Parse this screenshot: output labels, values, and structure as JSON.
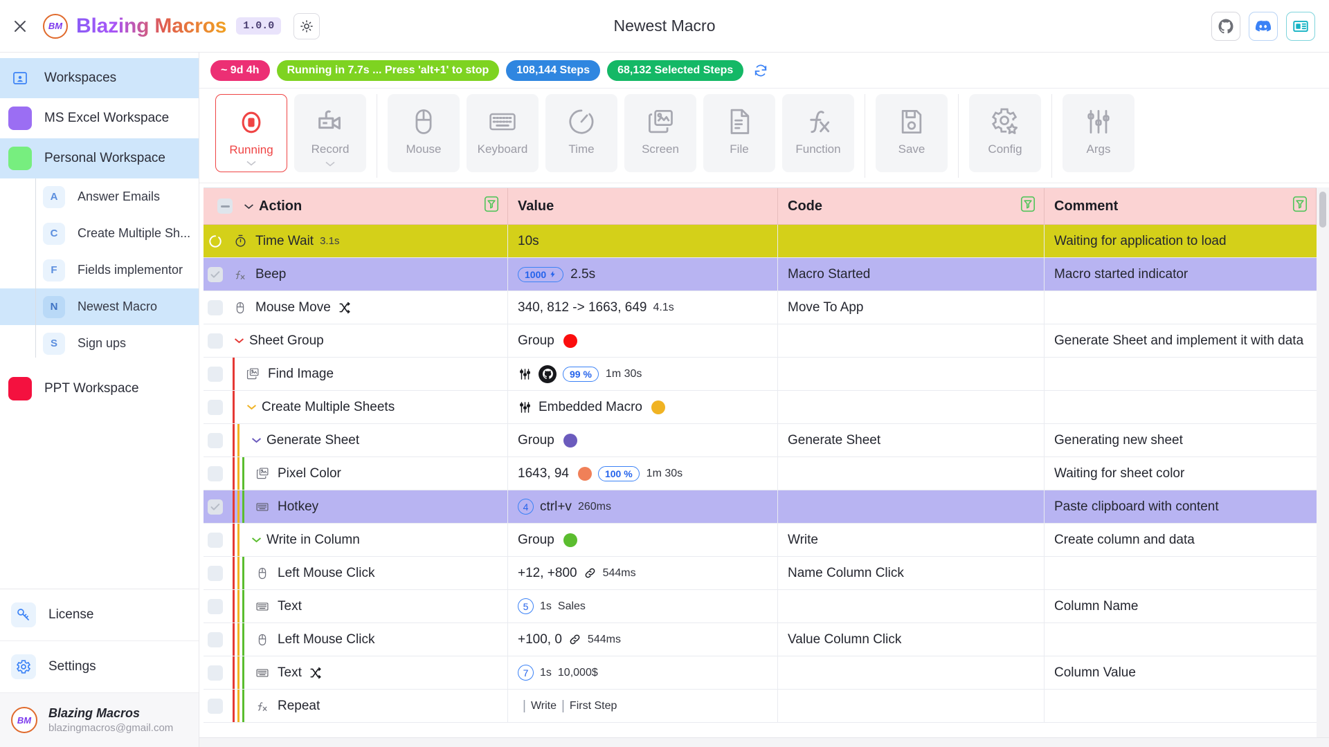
{
  "app": {
    "brand": "Blazing Macros",
    "version": "1.0.0",
    "window_title": "Newest Macro",
    "close_icon": "close-icon",
    "theme_icon": "sun-icon",
    "github_icon": "github-icon",
    "discord_icon": "discord-icon",
    "news_icon": "news-icon"
  },
  "sidebar": {
    "workspaces_label": "Workspaces",
    "workspaces": [
      {
        "label": "MS Excel Workspace",
        "color": "#9b6ef3",
        "active": false
      },
      {
        "label": "Personal Workspace",
        "color": "#77ee7f",
        "active": true
      }
    ],
    "macros": [
      {
        "initial": "A",
        "label": "Answer Emails",
        "active": false
      },
      {
        "initial": "C",
        "label": "Create Multiple Sh...",
        "active": false
      },
      {
        "initial": "F",
        "label": "Fields implementor",
        "active": false
      },
      {
        "initial": "N",
        "label": "Newest Macro",
        "active": true
      },
      {
        "initial": "S",
        "label": "Sign ups",
        "active": false
      }
    ],
    "workspace_last": {
      "label": "PPT Workspace",
      "color": "#f4113f"
    },
    "footer": [
      {
        "label": "License",
        "icon": "key-icon"
      },
      {
        "label": "Settings",
        "icon": "gear-icon"
      }
    ],
    "user": {
      "name": "Blazing Macros",
      "email": "blazingmacros@gmail.com"
    }
  },
  "status": {
    "badges": [
      {
        "text": "~ 9d 4h",
        "color": "#ec2f74"
      },
      {
        "text": "Running in 7.7s ... Press 'alt+1' to stop",
        "color": "#7ed321"
      },
      {
        "text": "108,144 Steps",
        "color": "#2f86e0"
      },
      {
        "text": "68,132 Selected Steps",
        "color": "#14b866"
      }
    ],
    "refresh_icon": "refresh-icon"
  },
  "toolbar": {
    "groups": [
      [
        {
          "label": "Running",
          "icon": "record-stop-icon",
          "active": true,
          "caret": true
        },
        {
          "label": "Record",
          "icon": "camera-icon",
          "active": false,
          "caret": true
        }
      ],
      [
        {
          "label": "Mouse",
          "icon": "mouse-icon"
        },
        {
          "label": "Keyboard",
          "icon": "keyboard-icon"
        },
        {
          "label": "Time",
          "icon": "timer-icon"
        },
        {
          "label": "Screen",
          "icon": "image-icon"
        },
        {
          "label": "File",
          "icon": "file-icon"
        },
        {
          "label": "Function",
          "icon": "function-icon"
        }
      ],
      [
        {
          "label": "Save",
          "icon": "save-icon"
        }
      ],
      [
        {
          "label": "Config",
          "icon": "config-gear-icon"
        }
      ],
      [
        {
          "label": "Args",
          "icon": "sliders-icon"
        }
      ]
    ]
  },
  "table": {
    "columns": [
      {
        "key": "action",
        "label": "Action",
        "filter": true
      },
      {
        "key": "value",
        "label": "Value",
        "filter": false
      },
      {
        "key": "code",
        "label": "Code",
        "filter": true
      },
      {
        "key": "comment",
        "label": "Comment",
        "filter": true
      }
    ],
    "rows": [
      {
        "action": "Time Wait",
        "duration": "3.1s",
        "icon": "stopwatch-icon",
        "value_text": "10s",
        "code": "",
        "comment": "Waiting for application to load",
        "highlight": "#d4d019",
        "indent": 0,
        "check": "spinner",
        "caret": null,
        "shuffle": false
      },
      {
        "action": "Beep",
        "duration": "",
        "icon": "fx-icon",
        "value_badge": "1000",
        "value_badge_icon": "lightning-icon",
        "value_text": "2.5s",
        "code": "Macro Started",
        "comment": "Macro started indicator",
        "highlight": "#b8b4f2",
        "indent": 0,
        "check": "checked",
        "caret": null,
        "shuffle": false
      },
      {
        "action": "Mouse Move",
        "duration": "",
        "icon": "mouse-icon",
        "value_text": "340, 812 -> 1663, 649",
        "value_dur": "4.1s",
        "code": "Move To App",
        "comment": "",
        "highlight": "",
        "indent": 0,
        "check": "empty",
        "caret": null,
        "shuffle": true
      },
      {
        "action": "Sheet Group",
        "duration": "",
        "icon": "",
        "value_text": "Group",
        "value_dot": "#fb0d0d",
        "code": "",
        "comment": "Generate Sheet and implement it with data",
        "highlight": "",
        "indent": 0,
        "check": "empty",
        "caret": "#e53935",
        "shuffle": false
      },
      {
        "action": "Find Image",
        "duration": "",
        "icon": "image-icon",
        "value_sliders": true,
        "value_github": true,
        "value_badge": "99 %",
        "value_dur": "1m 30s",
        "code": "",
        "comment": "",
        "highlight": "",
        "indent": 1,
        "check": "empty",
        "caret": null,
        "shuffle": false
      },
      {
        "action": "Create Multiple Sheets",
        "duration": "",
        "icon": "",
        "value_sliders": true,
        "value_text": "Embedded Macro",
        "value_dot": "#f0b323",
        "code": "",
        "comment": "",
        "highlight": "",
        "indent": 1,
        "check": "empty",
        "caret": "#f0b323",
        "shuffle": false
      },
      {
        "action": "Generate Sheet",
        "duration": "",
        "icon": "",
        "value_text": "Group",
        "value_dot": "#6b5bbd",
        "code": "Generate Sheet",
        "comment": "Generating new sheet",
        "highlight": "",
        "indent": 2,
        "check": "empty",
        "caret": "#6b5bbd",
        "shuffle": false
      },
      {
        "action": "Pixel Color",
        "duration": "",
        "icon": "image-icon",
        "value_text": "1643, 94",
        "value_dot": "#f08058",
        "value_badge": "100 %",
        "value_dur": "1m 30s",
        "code": "",
        "comment": "Waiting for sheet color",
        "highlight": "",
        "indent": 3,
        "check": "empty",
        "caret": null,
        "shuffle": false
      },
      {
        "action": "Hotkey",
        "duration": "",
        "icon": "keyboard-icon",
        "value_text": "ctrl+v",
        "value_circle": "4",
        "value_dur": "260ms",
        "code": "",
        "comment": "Paste clipboard with content",
        "highlight": "#b8b4f2",
        "indent": 3,
        "check": "checked",
        "caret": null,
        "shuffle": false
      },
      {
        "action": "Write in Column",
        "duration": "",
        "icon": "",
        "value_text": "Group",
        "value_dot": "#5bbd2f",
        "code": "Write",
        "comment": "Create column and data",
        "highlight": "",
        "indent": 2,
        "check": "empty",
        "caret": "#5bbd2f",
        "shuffle": false
      },
      {
        "action": "Left Mouse Click",
        "duration": "",
        "icon": "mouse-icon",
        "value_text": "+12, +800",
        "value_link": true,
        "value_dur": "544ms",
        "code": "Name Column Click",
        "comment": "",
        "highlight": "",
        "indent": 3,
        "check": "empty",
        "caret": null,
        "shuffle": false
      },
      {
        "action": "Text",
        "duration": "",
        "icon": "keyboard-icon",
        "value_circle": "5",
        "value_dur": "1s",
        "value_text2": "Sales",
        "code": "",
        "comment": "Column Name",
        "highlight": "",
        "indent": 3,
        "check": "empty",
        "caret": null,
        "shuffle": false
      },
      {
        "action": "Left Mouse Click",
        "duration": "",
        "icon": "mouse-icon",
        "value_text": "+100, 0",
        "value_link": true,
        "value_dur": "544ms",
        "code": "Value Column Click",
        "comment": "",
        "highlight": "",
        "indent": 3,
        "check": "empty",
        "caret": null,
        "shuffle": false
      },
      {
        "action": "Text",
        "duration": "",
        "icon": "keyboard-icon",
        "value_circle": "7",
        "value_dur": "1s",
        "value_text2": "10,000$",
        "code": "",
        "comment": "Column Value",
        "highlight": "",
        "indent": 3,
        "check": "empty",
        "caret": null,
        "shuffle": true
      },
      {
        "action": "Repeat",
        "duration": "",
        "icon": "fx-icon",
        "value_repeat": [
          "Write",
          "First Step"
        ],
        "code": "",
        "comment": "",
        "highlight": "",
        "indent": 3,
        "check": "empty",
        "caret": null,
        "shuffle": false
      }
    ],
    "indent_colors": [
      "#e53935",
      "#f0b323",
      "#5bbd2f",
      "#6b5bbd"
    ]
  }
}
